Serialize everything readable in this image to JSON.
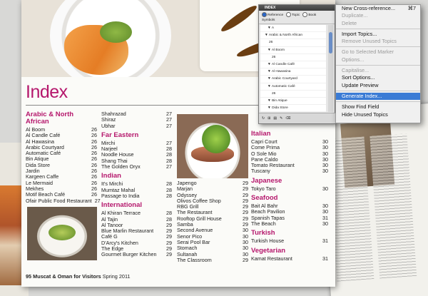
{
  "page": {
    "title": "Index",
    "footer": {
      "page_number": "95",
      "publication": "Muscat & Oman for Visitors",
      "issue": "Spring 2011"
    }
  },
  "index_columns": [
    [
      {
        "heading": "Arabic & North African",
        "entries": [
          [
            "Al Boom",
            "26"
          ],
          [
            "Al Candle Café",
            "26"
          ],
          [
            "Al Hawasina",
            "26"
          ],
          [
            "Arabic Courtyard",
            "26"
          ],
          [
            "Automatic Café",
            "26"
          ],
          [
            "Bin Atique",
            "26"
          ],
          [
            "Dida Store",
            "26"
          ],
          [
            "Jardin",
            "26"
          ],
          [
            "Kargeen Caffe",
            "26"
          ],
          [
            "Le Mermaid",
            "26"
          ],
          [
            "Mekhes",
            "26"
          ],
          [
            "Motif Beach Café",
            "26"
          ],
          [
            "Ofair Public Food Restaurant",
            "27"
          ]
        ]
      }
    ],
    [
      {
        "heading": "",
        "entries": [
          [
            "Shahrazad",
            "27"
          ],
          [
            "Shiraz",
            "27"
          ],
          [
            "Ubhar",
            "27"
          ]
        ]
      },
      {
        "heading": "Far Eastern",
        "entries": [
          [
            "Mirchi",
            "27"
          ],
          [
            "Narjeel",
            "28"
          ],
          [
            "Noodle House",
            "28"
          ],
          [
            "Shang Thai",
            "28"
          ],
          [
            "The Golden Oryx",
            "27"
          ]
        ]
      },
      {
        "heading": "Indian",
        "entries": [
          [
            "It's Mirchi",
            "28"
          ],
          [
            "Mumtaz Mahal",
            "28"
          ],
          [
            "Passage to India",
            "28"
          ]
        ]
      },
      {
        "heading": "International",
        "entries": [
          [
            "Al Khiran Terrace",
            "28"
          ],
          [
            "Al Tajin",
            "28"
          ],
          [
            "Al Tanoor",
            "29"
          ],
          [
            "Blue Marlin Restaurant",
            "29"
          ],
          [
            "Café G",
            "29"
          ],
          [
            "D'Arcy's Kitchen",
            "29"
          ],
          [
            "The Edge",
            "29"
          ],
          [
            "Gourmet Burger Kitchen",
            "29"
          ]
        ]
      }
    ],
    [
      {
        "heading": "",
        "entries": [
          [
            "Japengo",
            "29"
          ],
          [
            "Marjan",
            "29"
          ],
          [
            "Odyssey",
            "29"
          ],
          [
            "Olivos Coffee Shop",
            "29"
          ],
          [
            "RBG Grill",
            "29"
          ],
          [
            "The Restaurant",
            "29"
          ],
          [
            "Rooftop Grill House",
            "29"
          ],
          [
            "Samba",
            "29"
          ],
          [
            "Second Avenue",
            "30"
          ],
          [
            "Senor Pico",
            "30"
          ],
          [
            "Serai Pool Bar",
            "30"
          ],
          [
            "Stomach",
            "30"
          ],
          [
            "Sultanah",
            "30"
          ],
          [
            "The Classroom",
            "29"
          ]
        ]
      }
    ],
    [
      {
        "heading": "Italian",
        "entries": [
          [
            "Capri Court",
            "30"
          ],
          [
            "Come Prima",
            "30"
          ],
          [
            "O Sole Mio",
            "30"
          ],
          [
            "Pane Caldo",
            "30"
          ],
          [
            "Tomato Restaurant",
            "30"
          ],
          [
            "Tuscany",
            "30"
          ]
        ]
      },
      {
        "heading": "Japanese",
        "entries": [
          [
            "Tokyo Taro",
            "30"
          ]
        ]
      },
      {
        "heading": "Seafood",
        "entries": [
          [
            "Bait Al Bahr",
            "30"
          ],
          [
            "Beach Pavilion",
            "30"
          ],
          [
            "Spanish Tapas",
            "31"
          ],
          [
            "The Beach",
            "30"
          ]
        ]
      },
      {
        "heading": "Turkish",
        "entries": [
          [
            "Turkish House",
            "31"
          ]
        ]
      },
      {
        "heading": "Vegetarian",
        "entries": [
          [
            "Kamat Restaurant",
            "31"
          ]
        ]
      }
    ]
  ],
  "index_panel": {
    "title": "INDEX",
    "tab_reference": "Reference",
    "tab_topic": "Topic",
    "tab_book": "Book",
    "sub_label": "Symbols",
    "tree_items": [
      "▼ A",
      "▼ Arabic & North African",
      "26",
      "▼ Al Boom",
      "26",
      "▼ Al Candle Café",
      "▼ Al Hawasina",
      "▼ Arabic Courtyard",
      "▼ Automatic Café",
      "26",
      "▼ Bin Atique",
      "▼ Dida Store"
    ],
    "bottom_buttons": [
      "↻",
      "⊞",
      "▤",
      "✎",
      "⌫"
    ]
  },
  "context_menu": {
    "items": [
      {
        "label": "New Cross-reference...",
        "shortcut": "⌘7",
        "disabled": false,
        "selected": false
      },
      {
        "label": "Duplicate...",
        "shortcut": "",
        "disabled": true,
        "selected": false
      },
      {
        "label": "Delete",
        "shortcut": "",
        "disabled": true,
        "selected": false
      },
      {
        "sep": true
      },
      {
        "label": "Import Topics...",
        "shortcut": "",
        "disabled": false,
        "selected": false
      },
      {
        "label": "Remove Unused Topics",
        "shortcut": "",
        "disabled": true,
        "selected": false
      },
      {
        "sep": true
      },
      {
        "label": "Go to Selected Marker",
        "shortcut": "",
        "disabled": true,
        "selected": false
      },
      {
        "label": "Options...",
        "shortcut": "",
        "disabled": true,
        "selected": false
      },
      {
        "sep": true
      },
      {
        "label": "Capitalise...",
        "shortcut": "",
        "disabled": true,
        "selected": false
      },
      {
        "label": "Sort Options...",
        "shortcut": "",
        "disabled": false,
        "selected": false
      },
      {
        "label": "Update Preview",
        "shortcut": "",
        "disabled": false,
        "selected": false
      },
      {
        "sep": true
      },
      {
        "label": "Generate Index...",
        "shortcut": "",
        "disabled": false,
        "selected": true
      },
      {
        "sep": true
      },
      {
        "label": "Show Find Field",
        "shortcut": "",
        "disabled": false,
        "selected": false
      },
      {
        "label": "Hide Unused Topics",
        "shortcut": "",
        "disabled": false,
        "selected": false
      }
    ]
  },
  "colors": {
    "accent": "#b5176c",
    "menu_highlight": "#3a7bd5"
  }
}
